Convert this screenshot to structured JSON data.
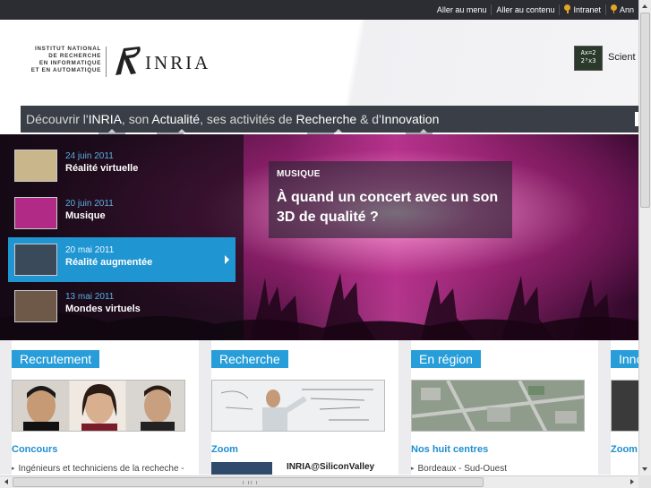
{
  "topbar": {
    "skip_menu": "Aller au menu",
    "skip_content": "Aller au contenu",
    "intranet": "Intranet",
    "cut_link": "Ann"
  },
  "header": {
    "institute": [
      "INSTITUT NATIONAL",
      "DE RECHERCHE",
      "EN INFORMATIQUE",
      "ET EN AUTOMATIQUE"
    ],
    "logo_word": "INRIA",
    "science_icon_text": [
      "Ax=2",
      "2³x3"
    ],
    "science_label": "Scient"
  },
  "nav": {
    "part1": "Découvrir l'",
    "inria": "INRIA",
    "part2": ", son ",
    "actualite": "Actualité",
    "part3": ", ses activités de ",
    "recherche": "Recherche",
    "part4": " & d'",
    "innovation": "Innovation"
  },
  "slider": {
    "items": [
      {
        "date": "24 juin 2011",
        "title": "Réalité virtuelle",
        "active": false,
        "thumb": "#c9b68a"
      },
      {
        "date": "20 juin 2011",
        "title": "Musique",
        "active": false,
        "thumb": "#b02a86"
      },
      {
        "date": "20 mai 2011",
        "title": "Réalité augmentée",
        "active": true,
        "thumb": "#3b4a5a"
      },
      {
        "date": "13 mai 2011",
        "title": "Mondes virtuels",
        "active": false,
        "thumb": "#6e5848"
      }
    ],
    "caption_kicker": "MUSIQUE",
    "caption_title": "À quand un concert avec un son 3D de qualité ?"
  },
  "blocks": [
    {
      "title": "Recrutement",
      "sub": "Concours",
      "line": "Ingénieurs et techniciens de la recheche -"
    },
    {
      "title": "Recherche",
      "sub": "Zoom",
      "zoom_title": "INRIA@SiliconValley"
    },
    {
      "title": "En région",
      "sub": "Nos huit centres",
      "line": "Bordeaux - Sud-Ouest"
    },
    {
      "title": "Inno",
      "sub": "Zoom"
    }
  ],
  "colors": {
    "accent": "#279ed9",
    "nav_bg": "#3a3f47",
    "topbar_bg": "#2b2d33"
  }
}
